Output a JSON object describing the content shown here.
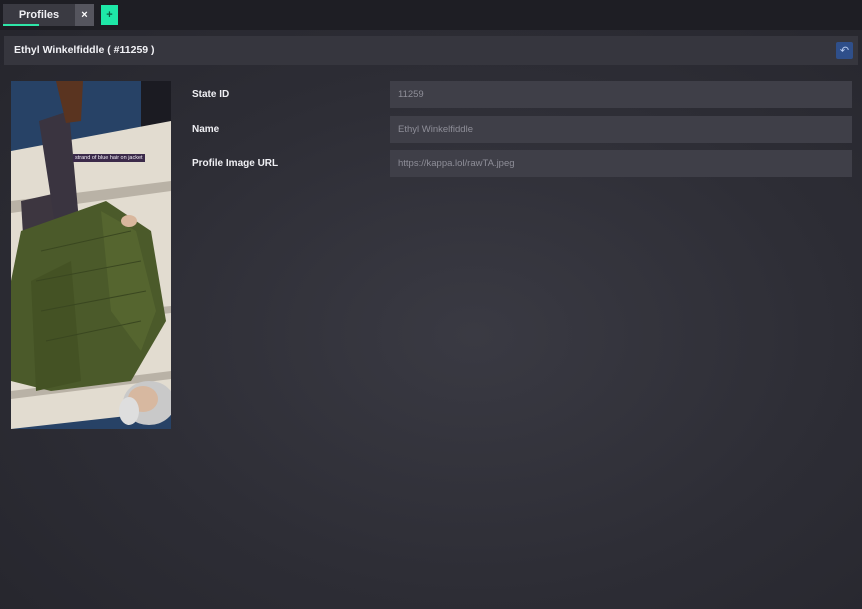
{
  "tabs": [
    {
      "label": "Profiles"
    }
  ],
  "tab_close_label": "×",
  "tab_add_label": "+",
  "header": {
    "title": "Ethyl Winkelfiddle ( #11259 )",
    "back_label": "↶"
  },
  "photo": {
    "caption": "strand of blue hair on jacket"
  },
  "fields": [
    {
      "label": "State ID",
      "value": "11259"
    },
    {
      "label": "Name",
      "value": "Ethyl Winkelfiddle"
    },
    {
      "label": "Profile Image URL",
      "value": "https://kappa.lol/rawTA.jpeg"
    }
  ],
  "colors": {
    "accent": "#1ee8a8",
    "back_button": "#2f4f8a"
  }
}
